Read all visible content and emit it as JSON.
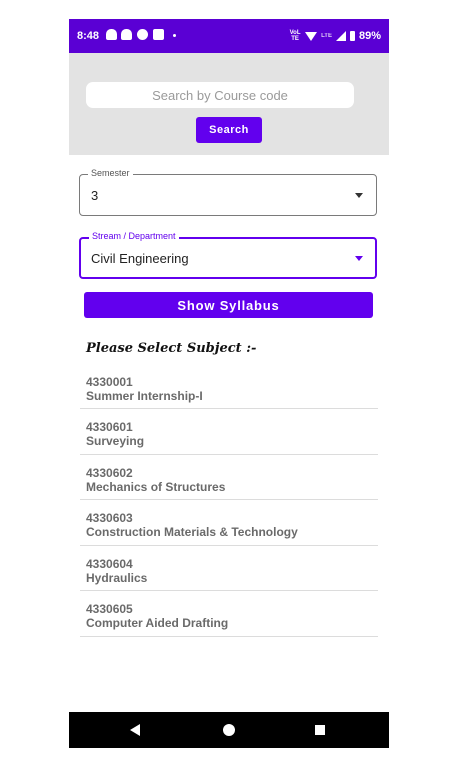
{
  "status_bar": {
    "time": "8:48",
    "volte": "VoLTE",
    "lte": "LTE",
    "battery": "89%"
  },
  "search": {
    "placeholder": "Search by Course code",
    "button_label": "Search"
  },
  "semester": {
    "label": "Semester",
    "value": "3"
  },
  "stream": {
    "label": "Stream / Department",
    "value": "Civil Engineering"
  },
  "show_button_label": "Show Syllabus",
  "subjects_heading": "Please Select Subject :-",
  "subjects": [
    {
      "code": "4330001",
      "name": "Summer Internship-I"
    },
    {
      "code": "4330601",
      "name": "Surveying"
    },
    {
      "code": "4330602",
      "name": "Mechanics of Structures"
    },
    {
      "code": "4330603",
      "name": "Construction Materials & Technology"
    },
    {
      "code": "4330604",
      "name": "Hydraulics"
    },
    {
      "code": "4330605",
      "name": "Computer Aided Drafting"
    }
  ],
  "colors": {
    "accent": "#6200ee",
    "status_bar": "#5a00d4",
    "search_bg": "#e3e3e3"
  }
}
